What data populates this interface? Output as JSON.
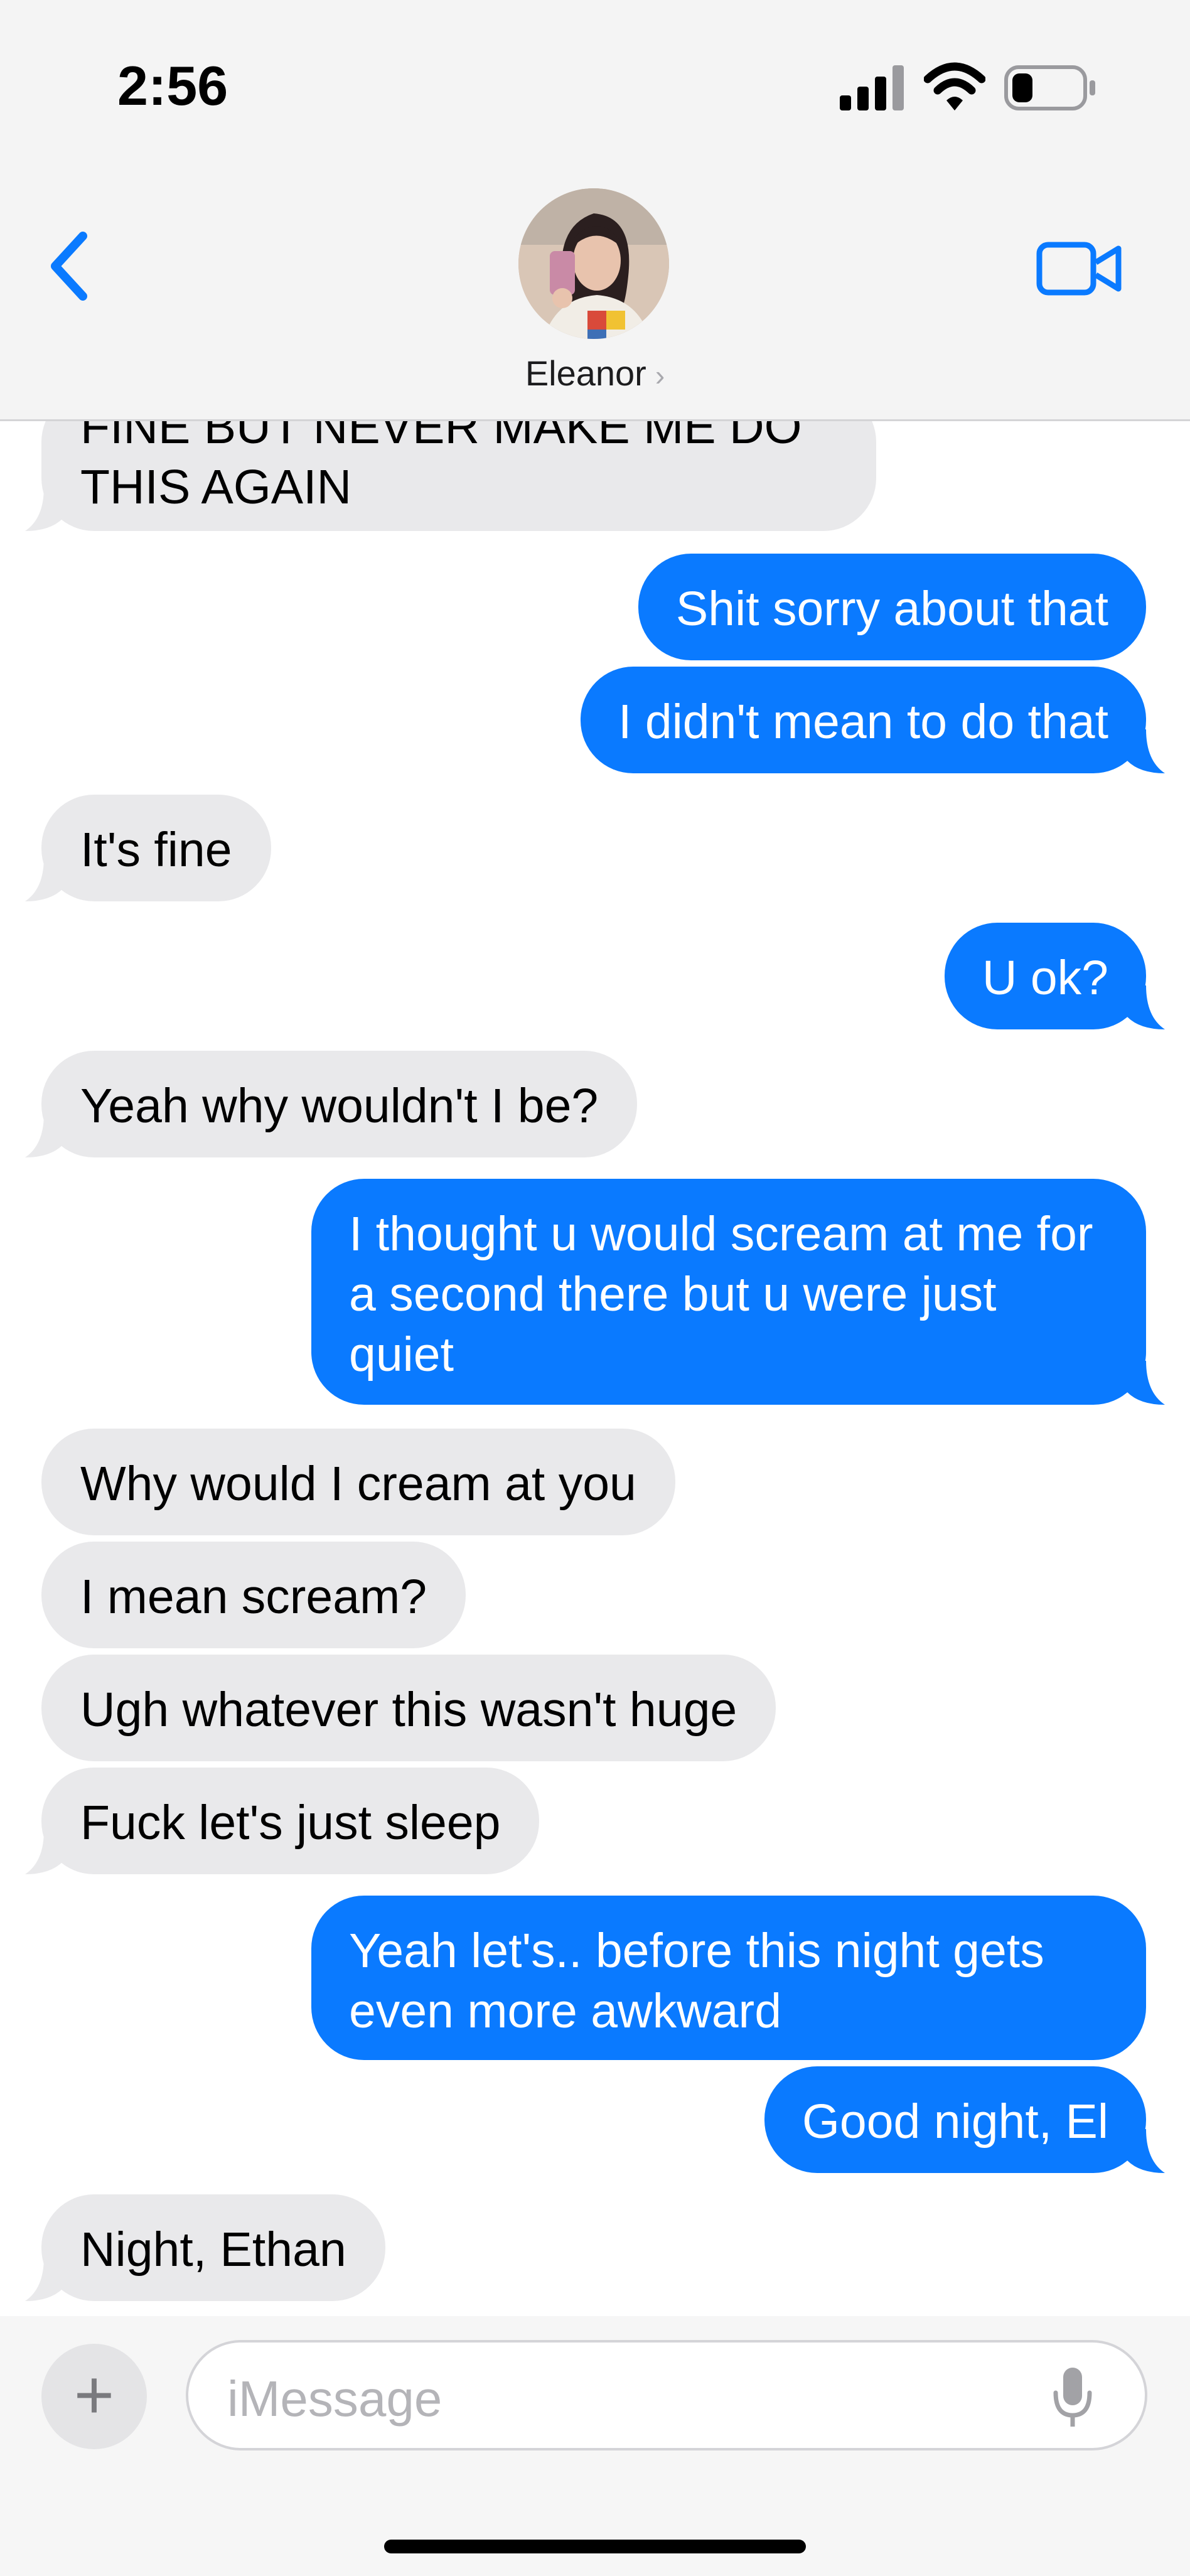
{
  "status_bar": {
    "time": "2:56",
    "battery_level": 0.3
  },
  "header": {
    "contact_name": "Eleanor",
    "chevron": "›"
  },
  "messages": [
    {
      "from": "them",
      "text": "FINE BUT NEVER MAKE ME DO THIS AGAIN"
    },
    {
      "from": "me",
      "text": "Shit sorry about that"
    },
    {
      "from": "me",
      "text": "I didn't mean to do that"
    },
    {
      "from": "them",
      "text": "It's fine"
    },
    {
      "from": "me",
      "text": "U ok?"
    },
    {
      "from": "them",
      "text": "Yeah why wouldn't I be?"
    },
    {
      "from": "me",
      "text": "I thought u would scream at me for a second there but u were just quiet"
    },
    {
      "from": "them",
      "text": "Why would I cream at you"
    },
    {
      "from": "them",
      "text": "I mean scream?"
    },
    {
      "from": "them",
      "text": "Ugh whatever this wasn't huge"
    },
    {
      "from": "them",
      "text": "Fuck let's just sleep"
    },
    {
      "from": "me",
      "text": "Yeah let's.. before this night gets even more awkward"
    },
    {
      "from": "me",
      "text": "Good night, El"
    },
    {
      "from": "them",
      "text": "Night, Ethan"
    }
  ],
  "composer": {
    "placeholder": "iMessage",
    "plus_label": "+"
  },
  "colors": {
    "incoming_bubble": "#e9e9eb",
    "outgoing_bubble": "#0a7aff",
    "accent": "#0a7aff"
  },
  "icons": [
    "back-chevron-icon",
    "video-camera-icon",
    "signal-icon",
    "wifi-icon",
    "battery-icon",
    "plus-icon",
    "microphone-icon"
  ]
}
